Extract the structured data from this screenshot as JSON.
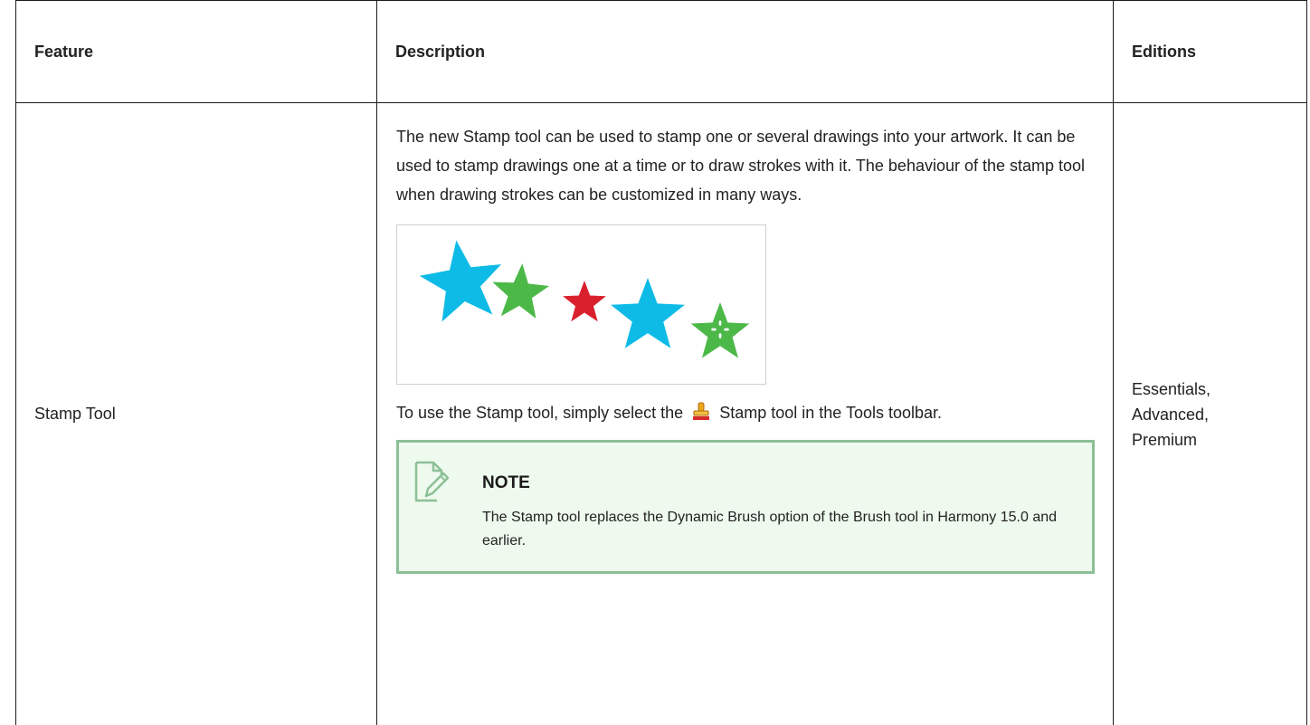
{
  "table": {
    "headers": {
      "feature": "Feature",
      "description": "Description",
      "editions": "Editions"
    },
    "row": {
      "feature": "Stamp Tool",
      "description": {
        "paragraph": "The new Stamp tool can be used to stamp one or several drawings into your artwork. It can be used to stamp drawings one at a time or to draw strokes with it. The behaviour of the stamp tool when drawing strokes can be customized in many ways.",
        "usage_before": "To use the Stamp tool, simply select the",
        "usage_after": "Stamp tool in the Tools toolbar.",
        "note": {
          "title": "NOTE",
          "body": "The Stamp tool replaces the Dynamic Brush option of the Brush tool in Harmony 15.0 and earlier."
        }
      },
      "editions": [
        "Essentials,",
        "Advanced,",
        "Premium"
      ]
    }
  },
  "colors": {
    "star_blue": "#0dbbe6",
    "star_green": "#4cb848",
    "star_red": "#d9212e",
    "note_background": "#eefaee",
    "note_border": "#8cbf97"
  },
  "icons": {
    "stamp": "stamp-tool-icon",
    "note": "note-pencil-icon"
  }
}
